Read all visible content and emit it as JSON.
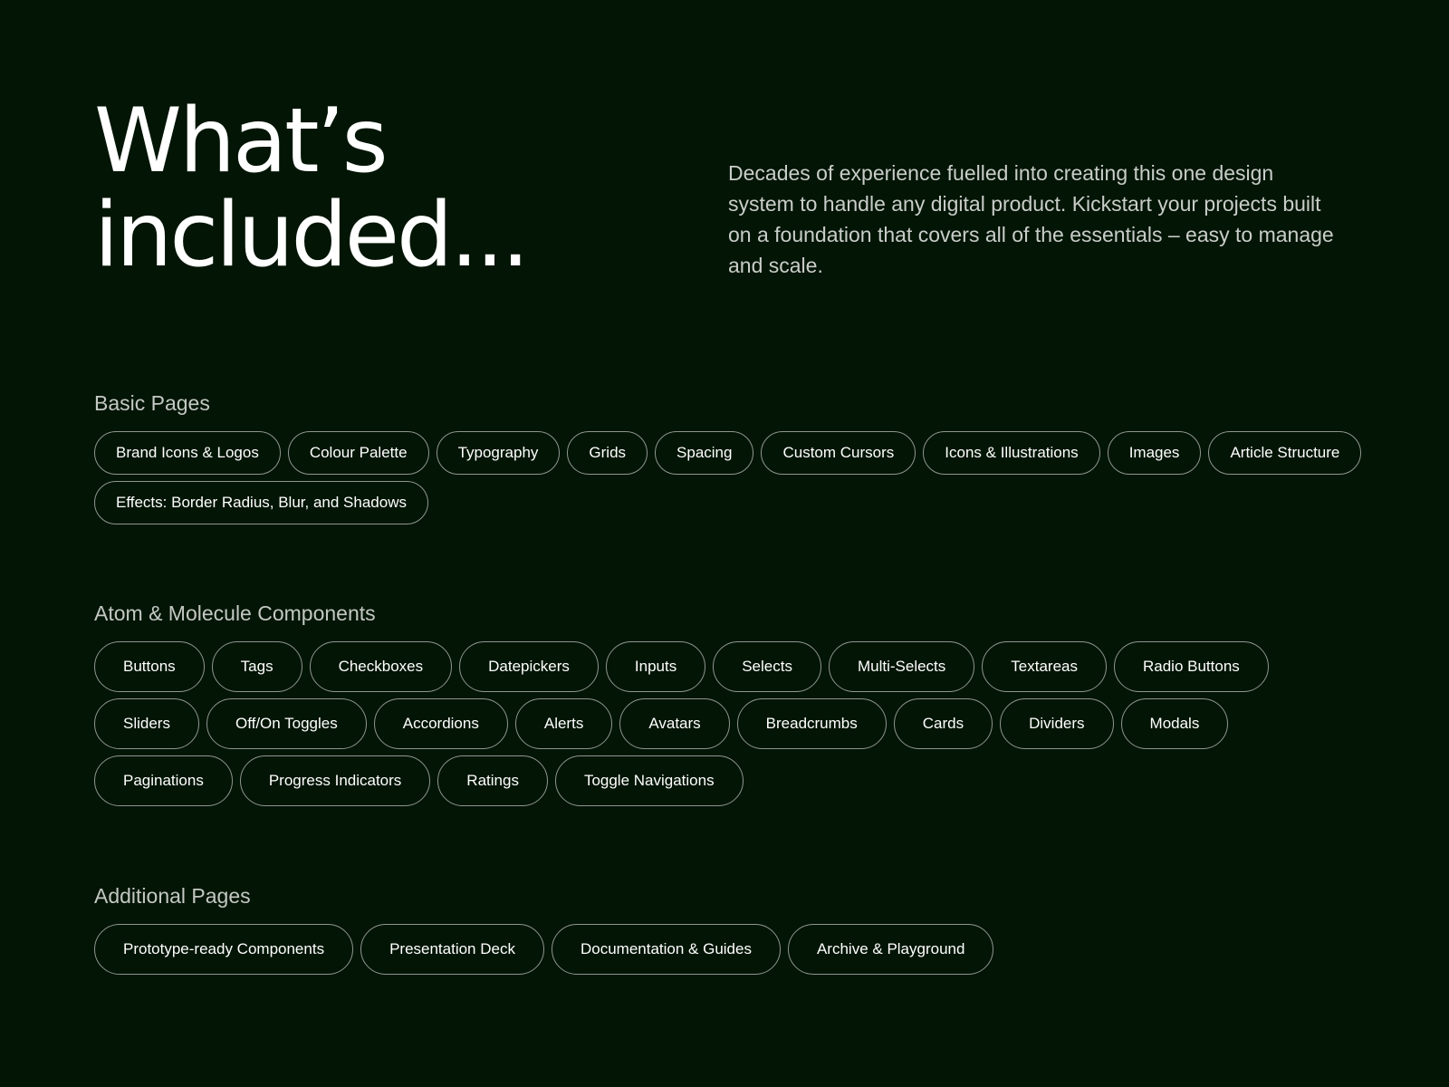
{
  "hero": {
    "title_line1": "What’s",
    "title_line2": "included...",
    "description": "Decades of experience fuelled into creating this one design system to handle any digital product. Kickstart your projects built on a foundation that covers all of the essentials – easy to manage and scale."
  },
  "colors": {
    "background": "#031505",
    "text": "#ffffff",
    "muted_text": "#c9cdc9",
    "pill_border": "#8f968f"
  },
  "sections": [
    {
      "title": "Basic Pages",
      "items": [
        "Brand Icons & Logos",
        "Colour Palette",
        "Typography",
        "Grids",
        "Spacing",
        "Custom Cursors",
        "Icons & Illustrations",
        "Images",
        "Article Structure",
        "Effects: Border Radius, Blur, and Shadows"
      ]
    },
    {
      "title": "Atom & Molecule Components",
      "items": [
        "Buttons",
        "Tags",
        "Checkboxes",
        "Datepickers",
        "Inputs",
        "Selects",
        "Multi-Selects",
        "Textareas",
        "Radio Buttons",
        "Sliders",
        "Off/On Toggles",
        "Accordions",
        "Alerts",
        "Avatars",
        "Breadcrumbs",
        "Cards",
        "Dividers",
        "Modals",
        "Paginations",
        "Progress Indicators",
        "Ratings",
        "Toggle Navigations"
      ]
    },
    {
      "title": "Additional Pages",
      "items": [
        "Prototype-ready Components",
        "Presentation Deck",
        "Documentation & Guides",
        "Archive & Playground"
      ]
    }
  ]
}
